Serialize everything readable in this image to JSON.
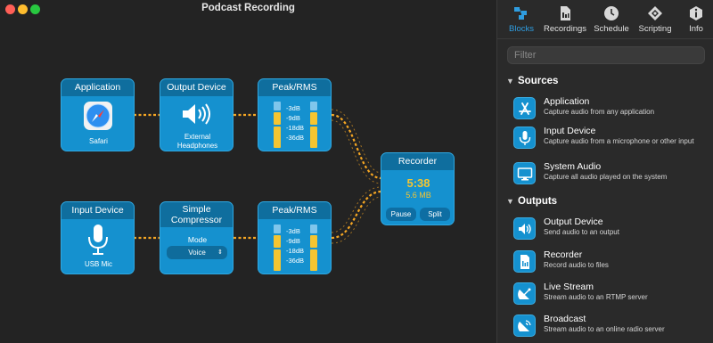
{
  "window": {
    "title": "Podcast Recording"
  },
  "blocks": {
    "application": {
      "title": "Application",
      "label": "Safari",
      "icon": "safari-compass-icon"
    },
    "output_device": {
      "title": "Output Device",
      "label": "External Headphones",
      "icon": "speaker-icon"
    },
    "peak_rms_top": {
      "title": "Peak/RMS",
      "levels": [
        "-3dB",
        "-9dB",
        "-18dB",
        "-36dB"
      ]
    },
    "recorder": {
      "title": "Recorder",
      "time": "5:38",
      "size": "5.6 MB",
      "pause_label": "Pause",
      "split_label": "Split"
    },
    "input_device": {
      "title": "Input Device",
      "label": "USB Mic",
      "icon": "microphone-icon"
    },
    "compressor": {
      "title_line1": "Simple",
      "title_line2": "Compressor",
      "mode_label": "Mode",
      "mode_value": "Voice"
    },
    "peak_rms_bottom": {
      "title": "Peak/RMS",
      "levels": [
        "-3dB",
        "-9dB",
        "-18dB",
        "-36dB"
      ]
    }
  },
  "toolbar": {
    "tabs": [
      {
        "label": "Blocks",
        "icon": "blocks-icon",
        "active": true
      },
      {
        "label": "Recordings",
        "icon": "recordings-icon",
        "active": false
      },
      {
        "label": "Schedule",
        "icon": "clock-icon",
        "active": false
      },
      {
        "label": "Scripting",
        "icon": "scripting-icon",
        "active": false
      },
      {
        "label": "Info",
        "icon": "info-icon",
        "active": false
      }
    ]
  },
  "filter": {
    "placeholder": "Filter"
  },
  "sources": {
    "heading": "Sources",
    "items": [
      {
        "name": "Application",
        "desc": "Capture audio from any application",
        "icon": "app-store-icon"
      },
      {
        "name": "Input Device",
        "desc": "Capture audio from a microphone or other input",
        "icon": "microphone-icon"
      },
      {
        "name": "System Audio",
        "desc": "Capture all audio played on the system",
        "icon": "monitor-icon"
      }
    ]
  },
  "outputs": {
    "heading": "Outputs",
    "items": [
      {
        "name": "Output Device",
        "desc": "Send audio to an output",
        "icon": "speaker-icon"
      },
      {
        "name": "Recorder",
        "desc": "Record audio to files",
        "icon": "document-icon"
      },
      {
        "name": "Live Stream",
        "desc": "Stream audio to an RTMP server",
        "icon": "satellite-icon"
      },
      {
        "name": "Broadcast",
        "desc": "Stream audio to an online radio server",
        "icon": "broadcast-icon"
      }
    ]
  },
  "colors": {
    "accent": "#2f9de0",
    "block": "#1591cf",
    "block_header": "#0f6e9e",
    "wire": "#f5a623",
    "recorder_text": "#f5c531"
  }
}
